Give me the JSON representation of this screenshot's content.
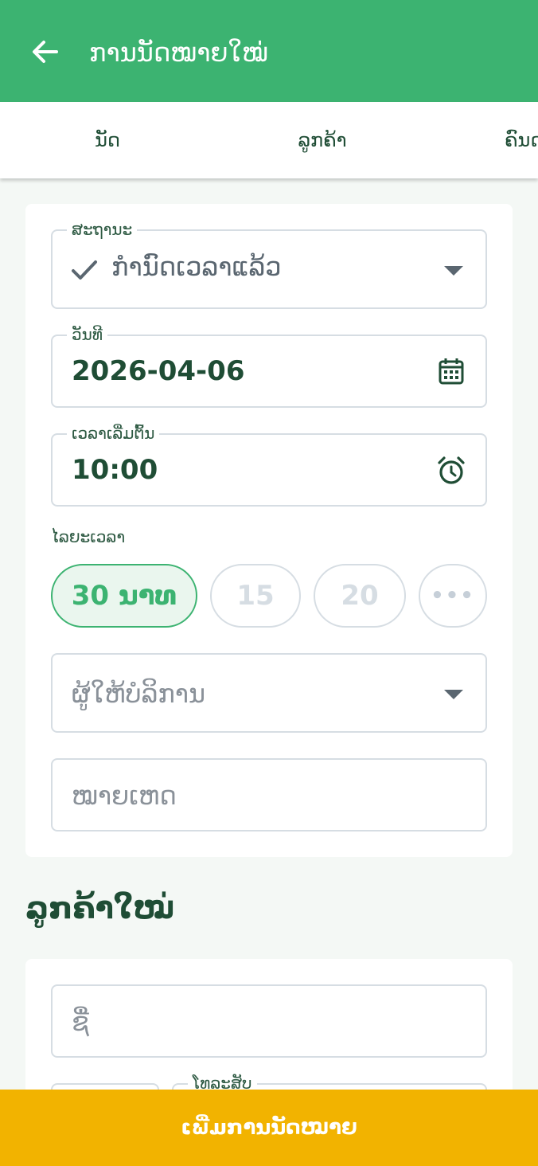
{
  "appbar": {
    "title": "ການນັດໝາຍໃໝ່",
    "back_icon": "arrow-left-icon"
  },
  "tabs": [
    "ນັດ",
    "ລູກຄ້າ",
    "ຄົນດ"
  ],
  "form": {
    "status": {
      "label": "ສະຖານະ",
      "value": "ກຳນົດເວລາແລ້ວ"
    },
    "date": {
      "label": "ວັນທີ",
      "value": "2026-04-06"
    },
    "start_time": {
      "label": "ເວລາເລີ່ມຕົ້ນ",
      "value": "10:00"
    },
    "duration": {
      "label": "ໄລຍະເວລາ",
      "options": [
        "30 ນາທ",
        "15",
        "20",
        "•••"
      ],
      "selected": "30 ນາທ"
    },
    "provider": {
      "placeholder": "ຜູ້ໃຫ້ບໍລິການ"
    },
    "note": {
      "placeholder": "ໝາຍເຫດ"
    }
  },
  "new_customer": {
    "title": "ລູກຄ້າໃໝ່",
    "name_placeholder": "ຊື່",
    "phone_label": "ໂທລະສັບ"
  },
  "submit_label": "ເພີ່ມການນັດໝາຍ",
  "colors": {
    "primary": "#3cb371",
    "accent": "#f2b300",
    "text_dark": "#1f4d35"
  }
}
